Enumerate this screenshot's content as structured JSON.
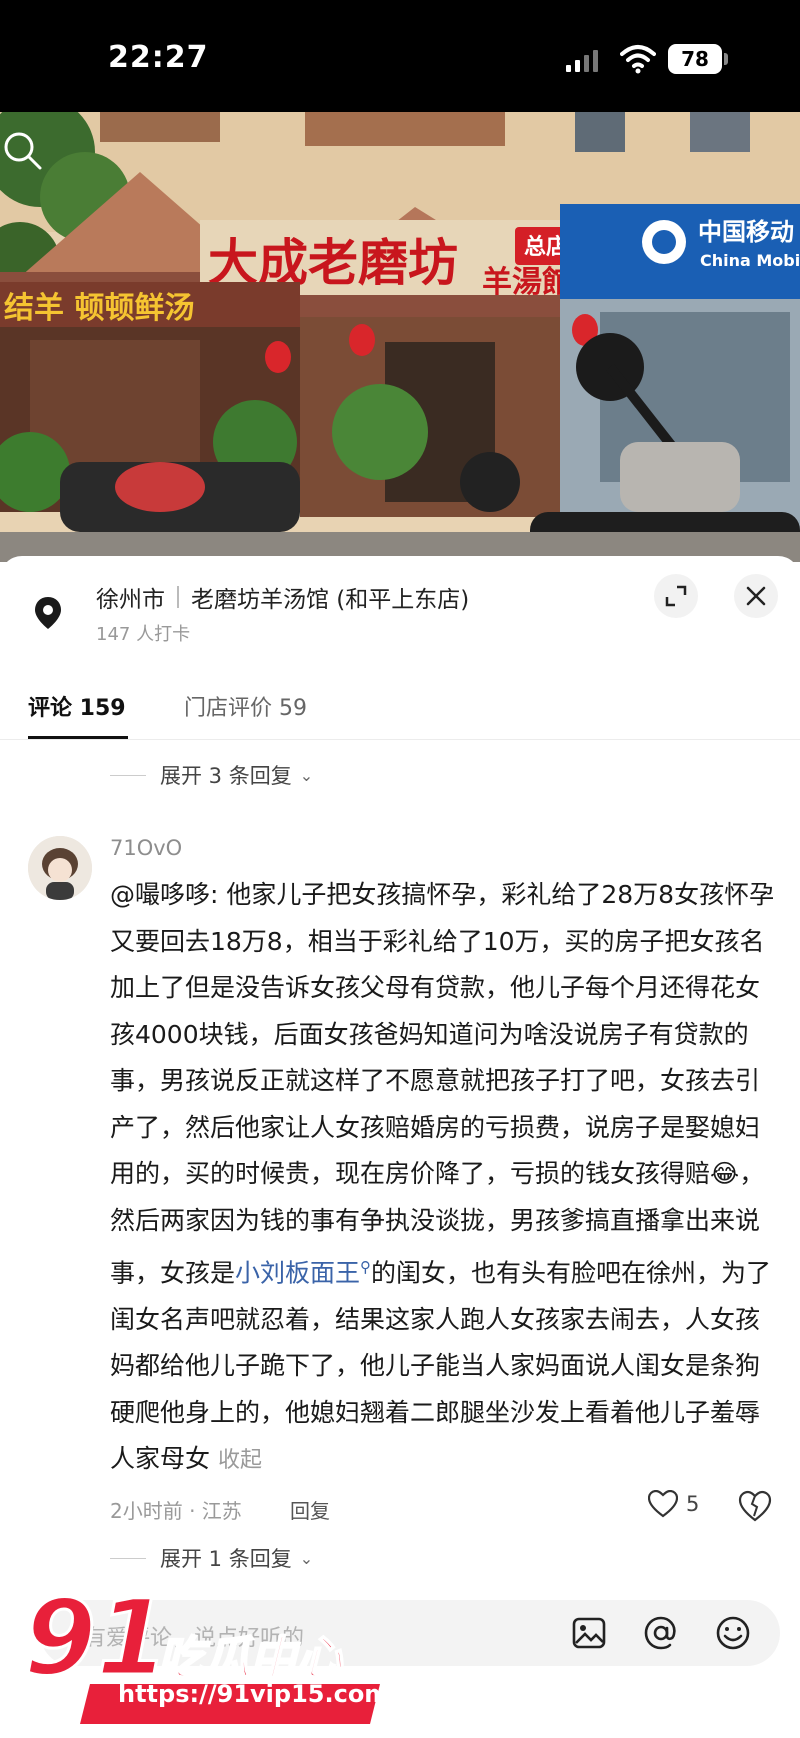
{
  "status": {
    "time": "22:27",
    "battery": "78"
  },
  "photo": {
    "sign_main": "大成老磨坊",
    "sign_suffix": "羊湯館",
    "sign_badge": "总店",
    "sign_left": "结羊 顿顿鲜汤",
    "sign_mobile_cn": "中国移动",
    "sign_mobile_en": "China Mobi"
  },
  "location": {
    "city": "徐州市",
    "place": "老磨坊羊汤馆 (和平上东店)",
    "checkins": "147 人打卡"
  },
  "tabs": [
    {
      "label": "评论 159"
    },
    {
      "label": "门店评价 59"
    }
  ],
  "replies_expand_top": "展开 3 条回复",
  "comment": {
    "username": "71OvO",
    "text_before": "@嘬哆哆: 他家儿子把女孩搞怀孕，彩礼给了28万8女孩怀孕又要回去18万8，相当于彩礼给了10万，买的房子把女孩名加上了但是没告诉女孩父母有贷款，他儿子每个月还得花女孩4000块钱，后面女孩爸妈知道问为啥没说房子有贷款的事，男孩说反正就这样了不愿意就把孩子打了吧，女孩去引产了，然后他家让人女孩赔婚房的亏损费，说房子是娶媳妇用的，买的时候贵，现在房价降了，亏损的钱女孩得赔",
    "emoji": "😂",
    "text_mid": "，然后两家因为钱的事有争执没谈拢，男孩爹搞直播拿出来说事，女孩是",
    "link_name": "小刘板面王",
    "text_after": "的闺女，也有头有脸吧在徐州，为了闺女名声吧就忍着，结果这家人跑人女孩家去闹去，人女孩妈都给他儿子跪下了，他儿子能当人家妈面说人闺女是条狗硬爬他身上的，他媳妇翘着二郎腿坐沙发上看着他儿子羞辱人家母女",
    "collapse": "收起",
    "time_location": "2小时前 · 江苏",
    "reply": "回复",
    "likes": "5"
  },
  "replies_expand_bottom": "展开 1 条回复",
  "input": {
    "placeholder": "有爱评论，说点好听的"
  },
  "watermark": {
    "logo": "91吃瓜中心",
    "url": "https://91vip15.com"
  },
  "colors": {
    "link": "#3a63a8",
    "watermark_red": "#e8203a"
  }
}
